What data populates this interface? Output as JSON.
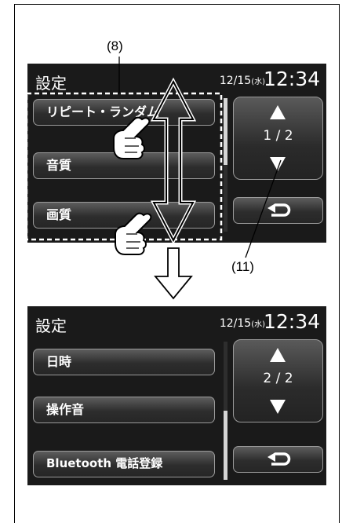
{
  "callouts": {
    "label_8": "(8)",
    "label_11": "(11)"
  },
  "screen1": {
    "title": "設定",
    "date": "12/15",
    "dow": "(水)",
    "time": "12:34",
    "items": [
      {
        "label": "リピート・ランダム"
      },
      {
        "label": "音質"
      },
      {
        "label": "画質"
      }
    ],
    "page": "1 / 2",
    "scroll_fraction": 0.5
  },
  "screen2": {
    "title": "設定",
    "date": "12/15",
    "dow": "(水)",
    "time": "12:34",
    "items": [
      {
        "label": "日時"
      },
      {
        "label": "操作音"
      },
      {
        "label": "Bluetooth 電話登録"
      }
    ],
    "page": "2 / 2",
    "scroll_fraction": 0.5
  },
  "colors": {
    "screen_bg": "#1a1a1a",
    "button_border": "#9a9a9a",
    "text": "#ffffff"
  }
}
